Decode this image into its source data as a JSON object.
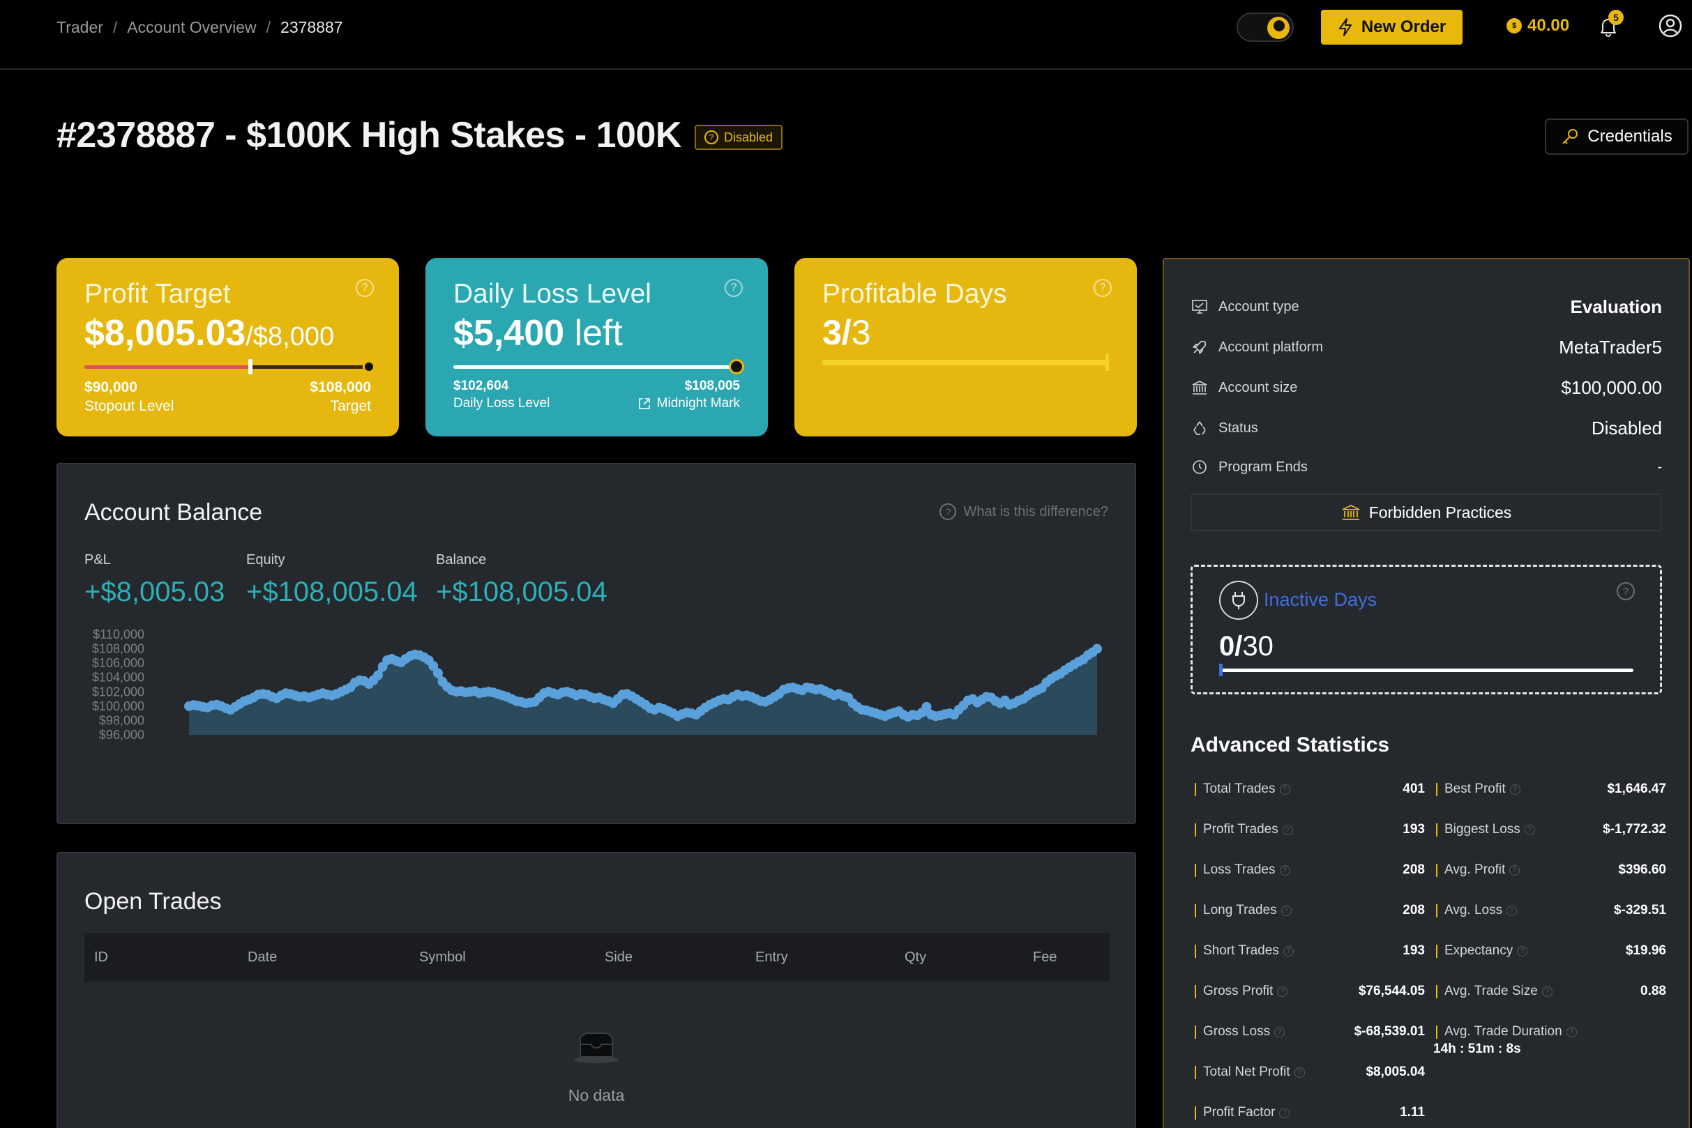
{
  "breadcrumb": {
    "items": [
      "Trader",
      "Account Overview",
      "2378887"
    ],
    "separator": "/"
  },
  "header": {
    "new_order_label": "New Order",
    "coins": "40.00",
    "notification_count": "5"
  },
  "page": {
    "title": "#2378887 - $100K High Stakes - 100K",
    "status_badge": "Disabled",
    "credentials_label": "Credentials"
  },
  "cards": {
    "profit_target": {
      "title": "Profit Target",
      "value": "$8,005.03",
      "target": "/$8,000",
      "left_amount": "$90,000",
      "left_label": "Stopout Level",
      "right_amount": "$108,000",
      "right_label": "Target",
      "progress": 0.58
    },
    "daily_loss": {
      "title": "Daily Loss Level",
      "value": "$5,400",
      "value_suffix": " left",
      "left_amount": "$102,604",
      "left_label": "Daily Loss Level",
      "right_amount": "$108,005",
      "right_label": "Midnight Mark"
    },
    "profitable_days": {
      "title": "Profitable Days",
      "value_bold": "3/",
      "value_rest": "3",
      "progress": 1.0
    }
  },
  "balance": {
    "title": "Account Balance",
    "hint": "What is this difference?",
    "metrics": [
      {
        "label": "P&L",
        "value": "+$8,005.03"
      },
      {
        "label": "Equity",
        "value": "+$108,005.04"
      },
      {
        "label": "Balance",
        "value": "+$108,005.04"
      }
    ]
  },
  "chart_data": {
    "type": "area",
    "title": "",
    "xlabel": "",
    "ylabel": "",
    "ylim": [
      96000,
      110000
    ],
    "y_ticks": [
      "$110,000",
      "$108,000",
      "$106,000",
      "$104,000",
      "$102,000",
      "$100,000",
      "$98,000",
      "$96,000"
    ],
    "series": [
      {
        "values": [
          100000,
          100150,
          100050,
          99900,
          99800,
          100100,
          100200,
          100000,
          99700,
          99500,
          99900,
          100300,
          100700,
          100900,
          101200,
          101600,
          101700,
          101600,
          101300,
          101100,
          101500,
          101800,
          101700,
          101500,
          101300,
          101400,
          101200,
          101400,
          101600,
          101800,
          101600,
          101500,
          101700,
          102000,
          102300,
          102600,
          103300,
          103600,
          103500,
          103100,
          103600,
          104300,
          105500,
          106400,
          106600,
          106300,
          106100,
          106600,
          107000,
          107200,
          107100,
          106800,
          106400,
          105600,
          104600,
          103400,
          102700,
          102200,
          102000,
          102100,
          101900,
          102000,
          102100,
          101800,
          101900,
          102000,
          101900,
          101700,
          101500,
          101300,
          101000,
          100700,
          100600,
          100400,
          100500,
          100600,
          101200,
          101800,
          102000,
          101800,
          101600,
          101900,
          102000,
          101800,
          101500,
          101700,
          101600,
          101300,
          101100,
          101200,
          100900,
          100700,
          100400,
          101000,
          101600,
          101700,
          101400,
          101000,
          100600,
          100200,
          99700,
          99500,
          99800,
          99600,
          99300,
          99000,
          98600,
          98900,
          99100,
          99000,
          98800,
          99300,
          99800,
          100200,
          100500,
          100800,
          101000,
          100900,
          101300,
          101600,
          101400,
          101500,
          101300,
          101000,
          100700,
          100600,
          100900,
          101300,
          101700,
          102300,
          102500,
          102600,
          102400,
          102200,
          102600,
          102500,
          102300,
          102400,
          102100,
          101800,
          101500,
          101700,
          101400,
          101200,
          100400,
          99900,
          99500,
          99400,
          99200,
          99000,
          98800,
          98600,
          98900,
          99100,
          99300,
          98800,
          98500,
          98800,
          98700,
          99100,
          99900,
          98800,
          98600,
          98700,
          98900,
          99000,
          98800,
          99500,
          100100,
          100800,
          101000,
          100500,
          100900,
          101300,
          101200,
          100700,
          100400,
          100800,
          100200,
          100400,
          100800,
          101000,
          101500,
          101900,
          102200,
          102500,
          103300,
          103800,
          104200,
          104500,
          105000,
          105400,
          105800,
          106200,
          106500,
          107100,
          107500,
          108000
        ]
      }
    ],
    "grid": false,
    "line_color": "#5aa0db",
    "fill_color": "#2b4a5c"
  },
  "trades": {
    "title": "Open Trades",
    "columns": [
      "ID",
      "Date",
      "Symbol",
      "Side",
      "Entry",
      "Qty",
      "Fee"
    ],
    "empty_text": "No data"
  },
  "account_info": {
    "rows": [
      {
        "icon": "monitor-icon",
        "label": "Account type",
        "value": "Evaluation"
      },
      {
        "icon": "rocket-icon",
        "label": "Account platform",
        "value": "MetaTrader5"
      },
      {
        "icon": "bank-icon",
        "label": "Account size",
        "value": "$100,000.00"
      },
      {
        "icon": "recycle-icon",
        "label": "Status",
        "value": "Disabled"
      },
      {
        "icon": "clock-icon",
        "label": "Program Ends",
        "value": "-"
      }
    ],
    "forbidden_label": "Forbidden Practices",
    "inactive": {
      "title": "Inactive Days",
      "value_bold": "0/",
      "value_rest": "30",
      "progress": 0.0
    }
  },
  "advanced": {
    "title": "Advanced Statistics",
    "left": [
      {
        "label": "Total Trades",
        "value": "401"
      },
      {
        "label": "Profit Trades",
        "value": "193"
      },
      {
        "label": "Loss Trades",
        "value": "208"
      },
      {
        "label": "Long Trades",
        "value": "208"
      },
      {
        "label": "Short Trades",
        "value": "193"
      },
      {
        "label": "Gross Profit",
        "value": "$76,544.05"
      },
      {
        "label": "Gross Loss",
        "value": "$-68,539.01"
      },
      {
        "label": "Total Net Profit",
        "value": "$8,005.04"
      },
      {
        "label": "Profit Factor",
        "value": "1.11"
      }
    ],
    "right": [
      {
        "label": "Best Profit",
        "value": "$1,646.47"
      },
      {
        "label": "Biggest Loss",
        "value": "$-1,772.32"
      },
      {
        "label": "Avg. Profit",
        "value": "$396.60"
      },
      {
        "label": "Avg. Loss",
        "value": "$-329.51"
      },
      {
        "label": "Expectancy",
        "value": "$19.96"
      },
      {
        "label": "Avg. Trade Size",
        "value": "0.88"
      },
      {
        "label": "Avg. Trade Duration",
        "value": ""
      }
    ],
    "avg_trade_duration": "14h : 51m : 8s"
  }
}
